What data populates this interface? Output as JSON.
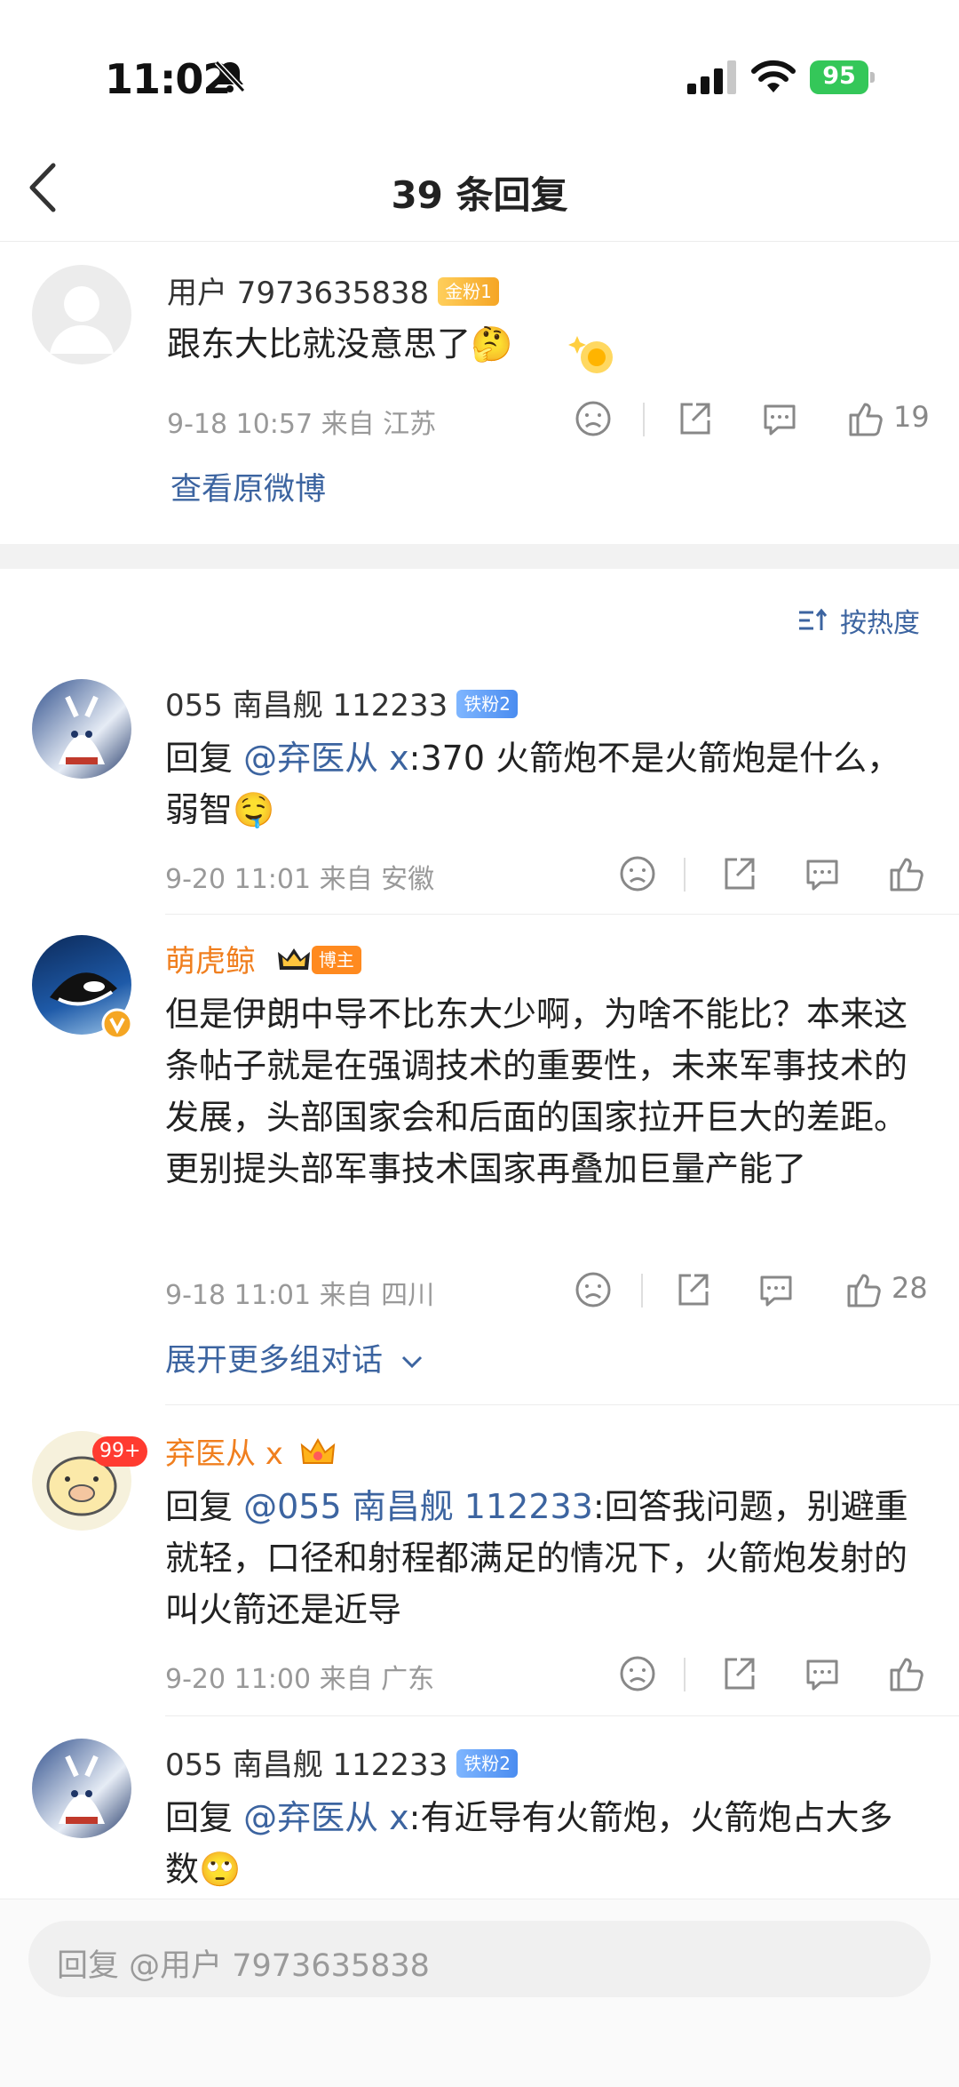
{
  "status_bar": {
    "time": "11:02",
    "battery": "95"
  },
  "nav": {
    "title": "39 条回复"
  },
  "main_comment": {
    "username": "用户 7973635838",
    "badge": "金粉1",
    "text": "跟东大比就没意思了🤔",
    "meta": "9-18 10:57  来自 江苏",
    "likes": "19",
    "view_original": "查看原微博"
  },
  "sort": {
    "label": "按热度"
  },
  "replies": [
    {
      "username": "055 南昌舰 112233",
      "badge": "铁粉2",
      "prefix": "回复 ",
      "mention": "@弃医从 x",
      "text": ":370 火箭炮不是火箭炮是什么，弱智🤤",
      "meta": "9-20 11:01  来自 安徽"
    },
    {
      "username": "萌虎鲸",
      "badge": "博主",
      "text": "但是伊朗中导不比东大少啊，为啥不能比？本来这条帖子就是在强调技术的重要性，未来军事技术的发展，头部国家会和后面的国家拉开巨大的差距。更别提头部军事技术国家再叠加巨量产能了",
      "meta": "9-18 11:01  来自 四川",
      "likes": "28",
      "expand": "展开更多组对话"
    },
    {
      "username": "弃医从 x",
      "prefix": "回复 ",
      "mention": "@055 南昌舰 112233",
      "text": ":回答我问题，别避重就轻，口径和射程都满足的情况下，火箭炮发射的叫火箭还是近导",
      "meta": "9-20 11:00  来自 广东",
      "avatar_badge": "99+"
    },
    {
      "username": "055 南昌舰 112233",
      "badge": "铁粉2",
      "prefix": "回复 ",
      "mention": "@弃医从 x",
      "text": ":有近导有火箭炮，火箭炮占大多数🙄",
      "meta": ""
    }
  ],
  "reply_bar": {
    "placeholder": "回复 @用户 7973635838"
  },
  "icons": [
    "bell-slash-icon",
    "signal-icon",
    "wifi-icon",
    "battery-icon",
    "back-icon",
    "dislike-icon",
    "share-icon",
    "comment-icon",
    "like-icon",
    "sort-icon",
    "chevron-down-icon"
  ],
  "colors": {
    "link": "#3c64a0",
    "owner_name": "#f07f1f",
    "battery": "#34c759"
  }
}
